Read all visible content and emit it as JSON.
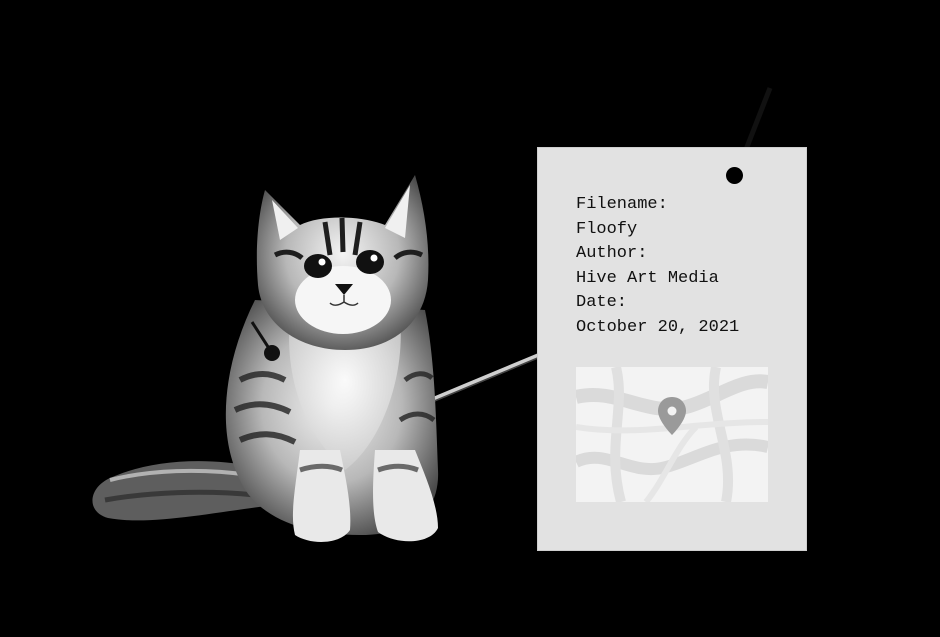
{
  "metadata_tag": {
    "filename_label": "Filename:",
    "filename_value": "Floofy",
    "author_label": "Author:",
    "author_value": "Hive Art Media",
    "date_label": "Date:",
    "date_value": "October 20, 2021"
  },
  "icons": {
    "map": "map-thumbnail",
    "pin": "location-pin-icon"
  },
  "colors": {
    "background": "#000000",
    "tag": "#e2e2e2",
    "text": "#111111",
    "map_base": "#f3f3f3",
    "map_roads": "#d9d9d9",
    "pin": "#9a9a9a"
  }
}
